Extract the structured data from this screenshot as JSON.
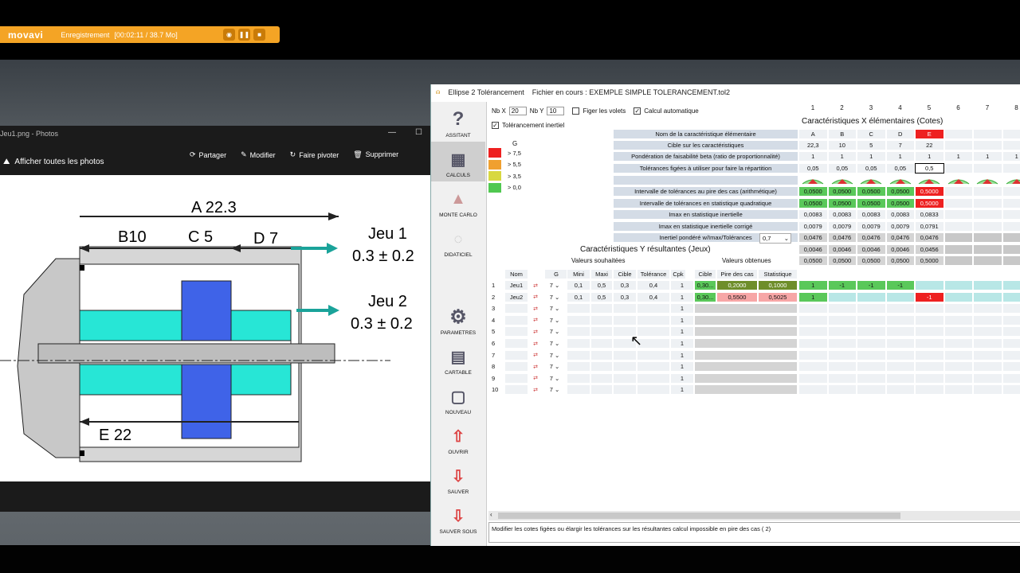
{
  "recorder": {
    "logo": "movavi",
    "status": "Enregistrement",
    "time": "[00:02:11 / 38.7 Mo]"
  },
  "photos": {
    "title": "Jeu1.png - Photos",
    "all_photos": "Afficher toutes les photos",
    "actions": [
      "Partager",
      "Modifier",
      "Faire pivoter",
      "Supprimer"
    ]
  },
  "drawing": {
    "dimA": "A 22.3",
    "dimB": "B10",
    "dimC": "C 5",
    "dimD": "D 7",
    "dimE": "E 22",
    "jeu1_name": "Jeu 1",
    "jeu1_tol": "0.3 ± 0.2",
    "jeu2_name": "Jeu 2",
    "jeu2_tol": "0.3 ± 0.2"
  },
  "app": {
    "title": "Ellipse 2 Tolérancement",
    "file": "Fichier en cours : EXEMPLE SIMPLE TOLERANCEMENT.tol2"
  },
  "sidebar": [
    "ASSITANT",
    "CALCULS",
    "MONTE CARLO",
    "DIDATICIEL",
    "PARAMETRES",
    "CARTABLE",
    "NOUVEAU",
    "OUVRIR",
    "SAUVER",
    "SAUVER SOUS"
  ],
  "controls": {
    "nbx_label": "Nb X",
    "nbx": "20",
    "nby_label": "Nb Y",
    "nby": "10",
    "figer": "Figer les volets",
    "calcul_auto": "Calcul automatique",
    "tol_inertiel": "Tolérancement inertiel"
  },
  "legend": {
    "title": "G",
    "items": [
      {
        "label": "> 7,5",
        "color": "#ee2020"
      },
      {
        "label": "> 5,5",
        "color": "#f0a030"
      },
      {
        "label": "> 3,5",
        "color": "#d8d840"
      },
      {
        "label": "> 0,0",
        "color": "#50c850"
      }
    ]
  },
  "xtable": {
    "col_numbers": [
      "1",
      "2",
      "3",
      "4",
      "5",
      "6",
      "7",
      "8"
    ],
    "heading": "Caractéristiques X élémentaires (Cotes)",
    "rows": [
      {
        "label": "Nom de la caractéristique élémentaire",
        "values": [
          "A",
          "B",
          "C",
          "D",
          "E",
          "",
          "",
          ""
        ]
      },
      {
        "label": "Cible sur les caractéristiques",
        "values": [
          "22,3",
          "10",
          "5",
          "7",
          "22",
          "",
          "",
          ""
        ]
      },
      {
        "label": "Pondération de faisabilité beta (ratio de proportionnalité)",
        "values": [
          "1",
          "1",
          "1",
          "1",
          "1",
          "1",
          "1",
          "1"
        ]
      },
      {
        "label": "Tolérances figées à utiliser pour faire la répartition",
        "values": [
          "0,05",
          "0,05",
          "0,05",
          "0,05",
          "0,5",
          "",
          "",
          ""
        ]
      },
      {
        "label": "",
        "values": [
          "",
          "",
          "",
          "",
          "",
          "",
          "",
          ""
        ]
      },
      {
        "label": "Intervalle de tolérances au pire des cas (arithmétique)",
        "values": [
          "0,0500",
          "0,0500",
          "0,0500",
          "0,0500",
          "0,5000",
          "",
          "",
          ""
        ]
      },
      {
        "label": "Intervalle de tolérances en statistique quadratique",
        "values": [
          "0,0500",
          "0,0500",
          "0,0500",
          "0,0500",
          "0,5000",
          "",
          "",
          ""
        ]
      },
      {
        "label": "Imax en statistique inertielle",
        "values": [
          "0,0083",
          "0,0083",
          "0,0083",
          "0,0083",
          "0,0833",
          "",
          "",
          ""
        ]
      },
      {
        "label": "Imax en statistique inertielle corrigé",
        "values": [
          "0,0079",
          "0,0079",
          "0,0079",
          "0,0079",
          "0,0791",
          "",
          "",
          ""
        ]
      },
      {
        "label": "Inertiel pondéré w/Imax/Tolérances",
        "values": [
          "0,0476",
          "0,0476",
          "0,0476",
          "0,0476",
          "0,0476",
          "",
          "",
          ""
        ]
      },
      {
        "label": "",
        "values": [
          "0,0046",
          "0,0046",
          "0,0046",
          "0,0046",
          "0,0456",
          "",
          "",
          ""
        ]
      },
      {
        "label": "",
        "values": [
          "0,0500",
          "0,0500",
          "0,0500",
          "0,0500",
          "0,5000",
          "",
          "",
          ""
        ]
      }
    ],
    "inertiel_select": "0,7"
  },
  "ytable": {
    "heading": "Caractéristiques Y résultantes (Jeux)",
    "souhaitees": "Valeurs souhaitées",
    "obtenues": "Valeurs obtenues",
    "headers": [
      "Nom",
      "G",
      "Mini",
      "Maxi",
      "Cible",
      "Tolérance",
      "Cpk",
      "Cible",
      "Pire des cas",
      "Statistique"
    ],
    "rows": [
      {
        "n": "1",
        "nom": "Jeu1",
        "g": "7",
        "mini": "0,1",
        "maxi": "0,5",
        "cible": "0,3",
        "tol": "0,4",
        "cpk": "1",
        "ocible": "0,30...",
        "pire": "0,2000",
        "stat": "0,1000",
        "x": [
          "1",
          "-1",
          "-1",
          "-1",
          "",
          "",
          "",
          ""
        ]
      },
      {
        "n": "2",
        "nom": "Jeu2",
        "g": "7",
        "mini": "0,1",
        "maxi": "0,5",
        "cible": "0,3",
        "tol": "0,4",
        "cpk": "1",
        "ocible": "0,30...",
        "pire": "0,5500",
        "stat": "0,5025",
        "x": [
          "1",
          "",
          "",
          "",
          "-1",
          "",
          "",
          ""
        ]
      },
      {
        "n": "3",
        "nom": "",
        "g": "7",
        "cpk": "1"
      },
      {
        "n": "4",
        "nom": "",
        "g": "7",
        "cpk": "1"
      },
      {
        "n": "5",
        "nom": "",
        "g": "7",
        "cpk": "1"
      },
      {
        "n": "6",
        "nom": "",
        "g": "7",
        "cpk": "1"
      },
      {
        "n": "7",
        "nom": "",
        "g": "7",
        "cpk": "1"
      },
      {
        "n": "8",
        "nom": "",
        "g": "7",
        "cpk": "1"
      },
      {
        "n": "9",
        "nom": "",
        "g": "7",
        "cpk": "1"
      },
      {
        "n": "10",
        "nom": "",
        "g": "7",
        "cpk": "1"
      }
    ]
  },
  "status": "Modifier les cotes figées ou élargir les tolérances sur les résultantes  calcul impossible en pire des cas ( 2)"
}
